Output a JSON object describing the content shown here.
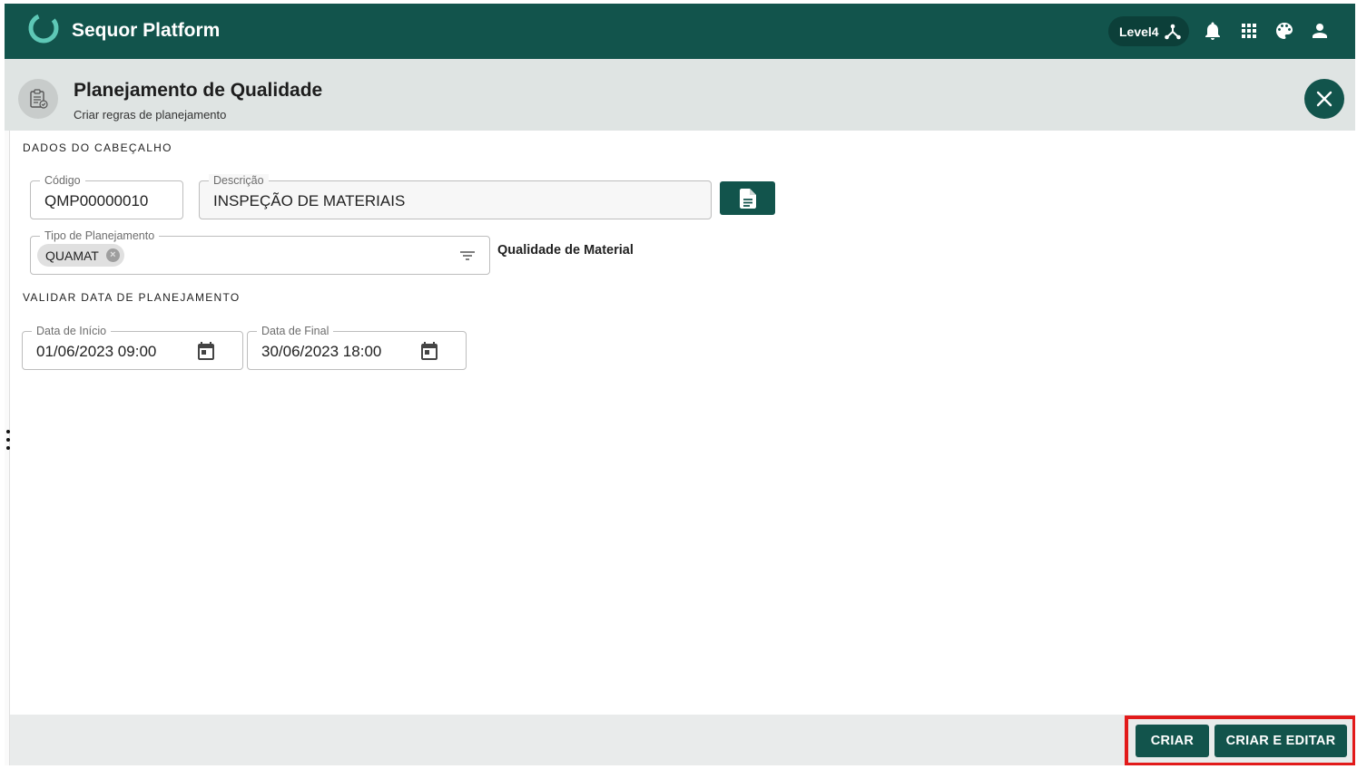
{
  "app": {
    "title": "Sequor Platform",
    "level": "Level4",
    "brand_color": "#12544c",
    "icons": [
      "logo-ring-icon",
      "hierarchy-icon",
      "bell-icon",
      "apps-grid-icon",
      "palette-icon",
      "user-icon"
    ]
  },
  "page": {
    "title": "Planejamento de Qualidade",
    "subtitle": "Criar regras de planejamento",
    "icon": "clipboard-check-icon"
  },
  "header_section": {
    "label": "DADOS DO CABEÇALHO",
    "codigo": {
      "label": "Código",
      "value": "QMP00000010"
    },
    "descricao": {
      "label": "Descrição",
      "value": "INSPEÇÃO DE MATERIAIS"
    },
    "tipo": {
      "label": "Tipo de Planejamento",
      "chip": "QUAMAT",
      "description": "Qualidade de Material"
    }
  },
  "validity_section": {
    "label": "VALIDAR DATA DE PLANEJAMENTO",
    "inicio": {
      "label": "Data de Início",
      "value": "01/06/2023 09:00"
    },
    "final": {
      "label": "Data de Final",
      "value": "30/06/2023 18:00"
    }
  },
  "footer": {
    "create_label": "CRIAR",
    "create_edit_label": "CRIAR E EDITAR",
    "highlight_color": "#e21a1a"
  }
}
